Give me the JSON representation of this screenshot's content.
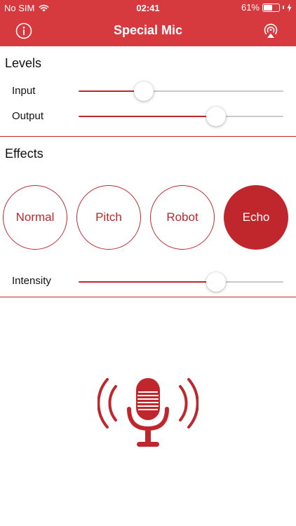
{
  "status_bar": {
    "carrier": "No SIM",
    "time": "02:41",
    "battery": "61%",
    "battery_level": 0.61
  },
  "nav": {
    "title": "Special Mic",
    "left_icon": "info-icon",
    "right_icon": "airplay-audio-icon"
  },
  "levels": {
    "title": "Levels",
    "input": {
      "label": "Input",
      "value": 0.32
    },
    "output": {
      "label": "Output",
      "value": 0.67
    }
  },
  "effects": {
    "title": "Effects",
    "options": [
      {
        "label": "Normal",
        "active": false
      },
      {
        "label": "Pitch",
        "active": false
      },
      {
        "label": "Robot",
        "active": false
      },
      {
        "label": "Echo",
        "active": true
      }
    ],
    "intensity": {
      "label": "Intensity",
      "value": 0.67
    }
  },
  "colors": {
    "accent": "#c0272d",
    "nav_bar": "#d63a3e",
    "track": "#c9c9c9"
  },
  "mic_icon": "microphone-broadcast-icon"
}
